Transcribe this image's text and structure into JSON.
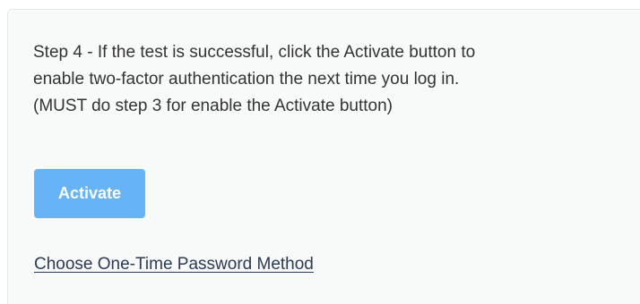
{
  "step4": {
    "lines": [
      "Step 4 - If the test is successful, click the Activate button to",
      "enable two-factor authentication the next time you log in.",
      "(MUST do step 3 for enable the Activate button)"
    ]
  },
  "activate_button": {
    "label": "Activate",
    "state": "disabled",
    "color": "#5fb1f7"
  },
  "otp_link": {
    "label": "Choose One-Time Password Method"
  }
}
